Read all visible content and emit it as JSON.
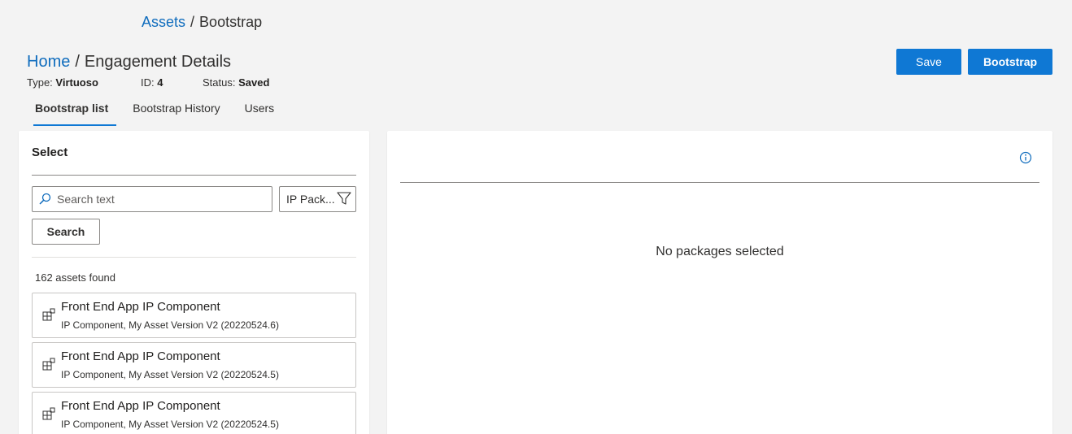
{
  "top_breadcrumb": {
    "link": "Assets",
    "separator": "/",
    "current": "Bootstrap"
  },
  "page_breadcrumb": {
    "home": "Home",
    "separator": "/",
    "current": "Engagement Details"
  },
  "meta": {
    "type_label": "Type:",
    "type_value": "Virtuoso",
    "id_label": "ID:",
    "id_value": "4",
    "status_label": "Status:",
    "status_value": "Saved"
  },
  "actions": {
    "save": "Save",
    "bootstrap": "Bootstrap"
  },
  "tabs": [
    {
      "label": "Bootstrap list",
      "active": true
    },
    {
      "label": "Bootstrap History",
      "active": false
    },
    {
      "label": "Users",
      "active": false
    }
  ],
  "left_panel": {
    "title": "Select",
    "search_placeholder": "Search text",
    "filter_value": "IP Pack...",
    "search_button": "Search",
    "count_text": "162 assets found",
    "assets": [
      {
        "name": "Front End App IP Component",
        "description": "IP Component, My Asset Version V2 (20220524.6)"
      },
      {
        "name": "Front End App IP Component",
        "description": "IP Component, My Asset Version V2 (20220524.5)"
      },
      {
        "name": "Front End App IP Component",
        "description": "IP Component, My Asset Version V2 (20220524.5)"
      }
    ]
  },
  "right_panel": {
    "empty_message": "No packages selected"
  },
  "colors": {
    "accent": "#0f78d4",
    "link": "#0f6cbd",
    "background": "#f3f3f3"
  }
}
